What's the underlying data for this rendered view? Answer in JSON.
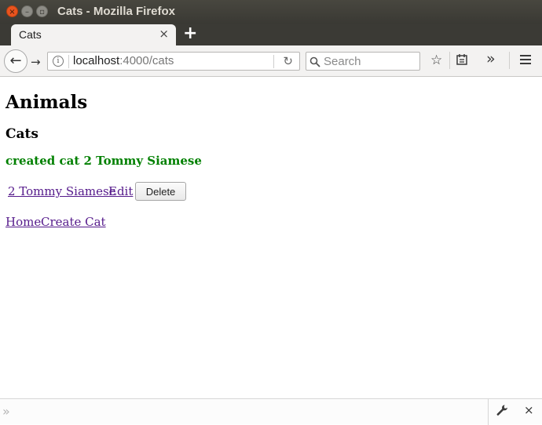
{
  "window": {
    "title": "Cats - Mozilla Firefox",
    "close_glyph": "×",
    "min_glyph": "–",
    "max_glyph": "▫"
  },
  "tabs": [
    {
      "label": "Cats",
      "close_glyph": "×",
      "active": true
    }
  ],
  "new_tab_glyph": "+",
  "nav": {
    "back_glyph": "←",
    "forward_glyph": "→",
    "info_glyph": "i",
    "url_host": "localhost",
    "url_rest": ":4000/cats",
    "reload_glyph": "↻",
    "search_placeholder": "Search",
    "bookmark_glyph": "☆",
    "overflow_glyph": "»",
    "menu_glyph": "≡"
  },
  "page": {
    "heading": "Animals",
    "subheading": "Cats",
    "flash": "created cat 2 Tommy Siamese",
    "cats": [
      {
        "link_label": "2 Tommy Siamese",
        "edit_label": "Edit",
        "delete_label": "Delete"
      }
    ],
    "links": {
      "home": "Home",
      "create": "Create Cat"
    },
    "flash_color": "#008000",
    "link_color": "#551a8b"
  },
  "devtools": {
    "chevron_glyph": "»",
    "close_glyph": "×"
  },
  "icons": [
    "back-arrow-icon",
    "forward-arrow-icon",
    "info-icon",
    "reload-icon",
    "search-icon",
    "bookmark-star-icon",
    "reading-list-icon",
    "overflow-chevron-icon",
    "hamburger-menu-icon",
    "wrench-icon",
    "close-icon"
  ]
}
